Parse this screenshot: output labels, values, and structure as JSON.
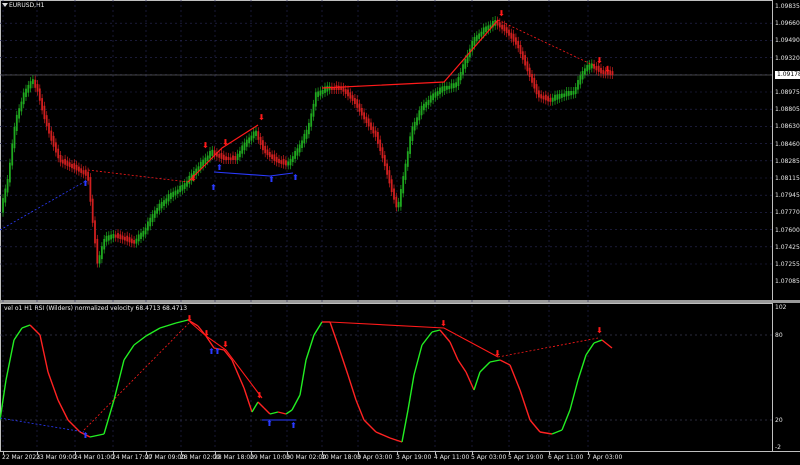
{
  "chart": {
    "symbol_title": "EURUSD,H1",
    "current_price": "1.09178",
    "price_axis": [
      "1.09835",
      "1.09660",
      "1.09490",
      "1.09320",
      "1.09150",
      "1.08975",
      "1.08805",
      "1.08630",
      "1.08460",
      "1.08285",
      "1.08115",
      "1.07945",
      "1.07770",
      "1.07600",
      "1.07425",
      "1.07255",
      "1.07085"
    ]
  },
  "indicator": {
    "title": "vel o1 H1 RSI (Wilders) normalized velocity 68.4713 68.4713",
    "axis": [
      "102",
      "80",
      "20",
      "-2"
    ]
  },
  "time_axis": [
    "22 Mar 2023",
    "23 Mar 09:00",
    "24 Mar 01:00",
    "24 Mar 17:00",
    "27 Mar 09:00",
    "28 Mar 02:00",
    "28 Mar 18:00",
    "29 Mar 10:00",
    "30 Mar 02:00",
    "30 Mar 18:00",
    "3 Apr 03:00",
    "3 Apr 19:00",
    "4 Apr 11:00",
    "5 Apr 03:00",
    "5 Apr 19:00",
    "6 Apr 11:00",
    "7 Apr 03:00"
  ],
  "colors": {
    "bull": "#1fa81f",
    "bear": "#d01f1f",
    "up_line": "#22ee22",
    "down_line": "#ff2222",
    "signal_up": "#2a3aff",
    "signal_down": "#ff1a1a",
    "grid": "#2a2a5a"
  }
}
